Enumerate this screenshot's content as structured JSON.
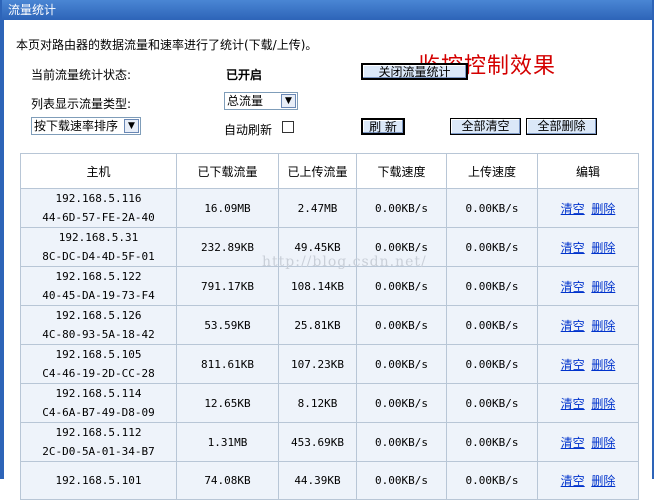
{
  "window": {
    "title": "流量统计"
  },
  "overlay_title": "监控控制效果",
  "description": "本页对路由器的数据流量和速率进行了统计(下载/上传)。",
  "status": {
    "label": "当前流量统计状态:",
    "value": "已开启",
    "toggle_button": "关闭流量统计"
  },
  "list_type": {
    "label": "列表显示流量类型:",
    "selected": "总流量"
  },
  "sort": {
    "selected": "按下载速率排序"
  },
  "auto_refresh": {
    "label": "自动刷新",
    "checked": false
  },
  "buttons": {
    "refresh": "刷 新",
    "clear_all": "全部清空",
    "delete_all": "全部删除"
  },
  "table": {
    "headers": [
      "主机",
      "已下载流量",
      "已上传流量",
      "下载速度",
      "上传速度",
      "编辑"
    ],
    "actions": {
      "clear": "清空",
      "delete": "删除"
    },
    "rows": [
      {
        "ip": "192.168.5.116",
        "mac": "44-6D-57-FE-2A-40",
        "down": "16.09MB",
        "up": "2.47MB",
        "down_speed": "0.00KB/s",
        "up_speed": "0.00KB/s"
      },
      {
        "ip": "192.168.5.31",
        "mac": "8C-DC-D4-4D-5F-01",
        "down": "232.89KB",
        "up": "49.45KB",
        "down_speed": "0.00KB/s",
        "up_speed": "0.00KB/s"
      },
      {
        "ip": "192.168.5.122",
        "mac": "40-45-DA-19-73-F4",
        "down": "791.17KB",
        "up": "108.14KB",
        "down_speed": "0.00KB/s",
        "up_speed": "0.00KB/s"
      },
      {
        "ip": "192.168.5.126",
        "mac": "4C-80-93-5A-18-42",
        "down": "53.59KB",
        "up": "25.81KB",
        "down_speed": "0.00KB/s",
        "up_speed": "0.00KB/s"
      },
      {
        "ip": "192.168.5.105",
        "mac": "C4-46-19-2D-CC-28",
        "down": "811.61KB",
        "up": "107.23KB",
        "down_speed": "0.00KB/s",
        "up_speed": "0.00KB/s"
      },
      {
        "ip": "192.168.5.114",
        "mac": "C4-6A-B7-49-D8-09",
        "down": "12.65KB",
        "up": "8.12KB",
        "down_speed": "0.00KB/s",
        "up_speed": "0.00KB/s"
      },
      {
        "ip": "192.168.5.112",
        "mac": "2C-D0-5A-01-34-B7",
        "down": "1.31MB",
        "up": "453.69KB",
        "down_speed": "0.00KB/s",
        "up_speed": "0.00KB/s"
      },
      {
        "ip": "192.168.5.101",
        "mac": "",
        "down": "74.08KB",
        "up": "44.39KB",
        "down_speed": "0.00KB/s",
        "up_speed": "0.00KB/s"
      }
    ]
  },
  "watermark": "http://blog.csdn.net/"
}
